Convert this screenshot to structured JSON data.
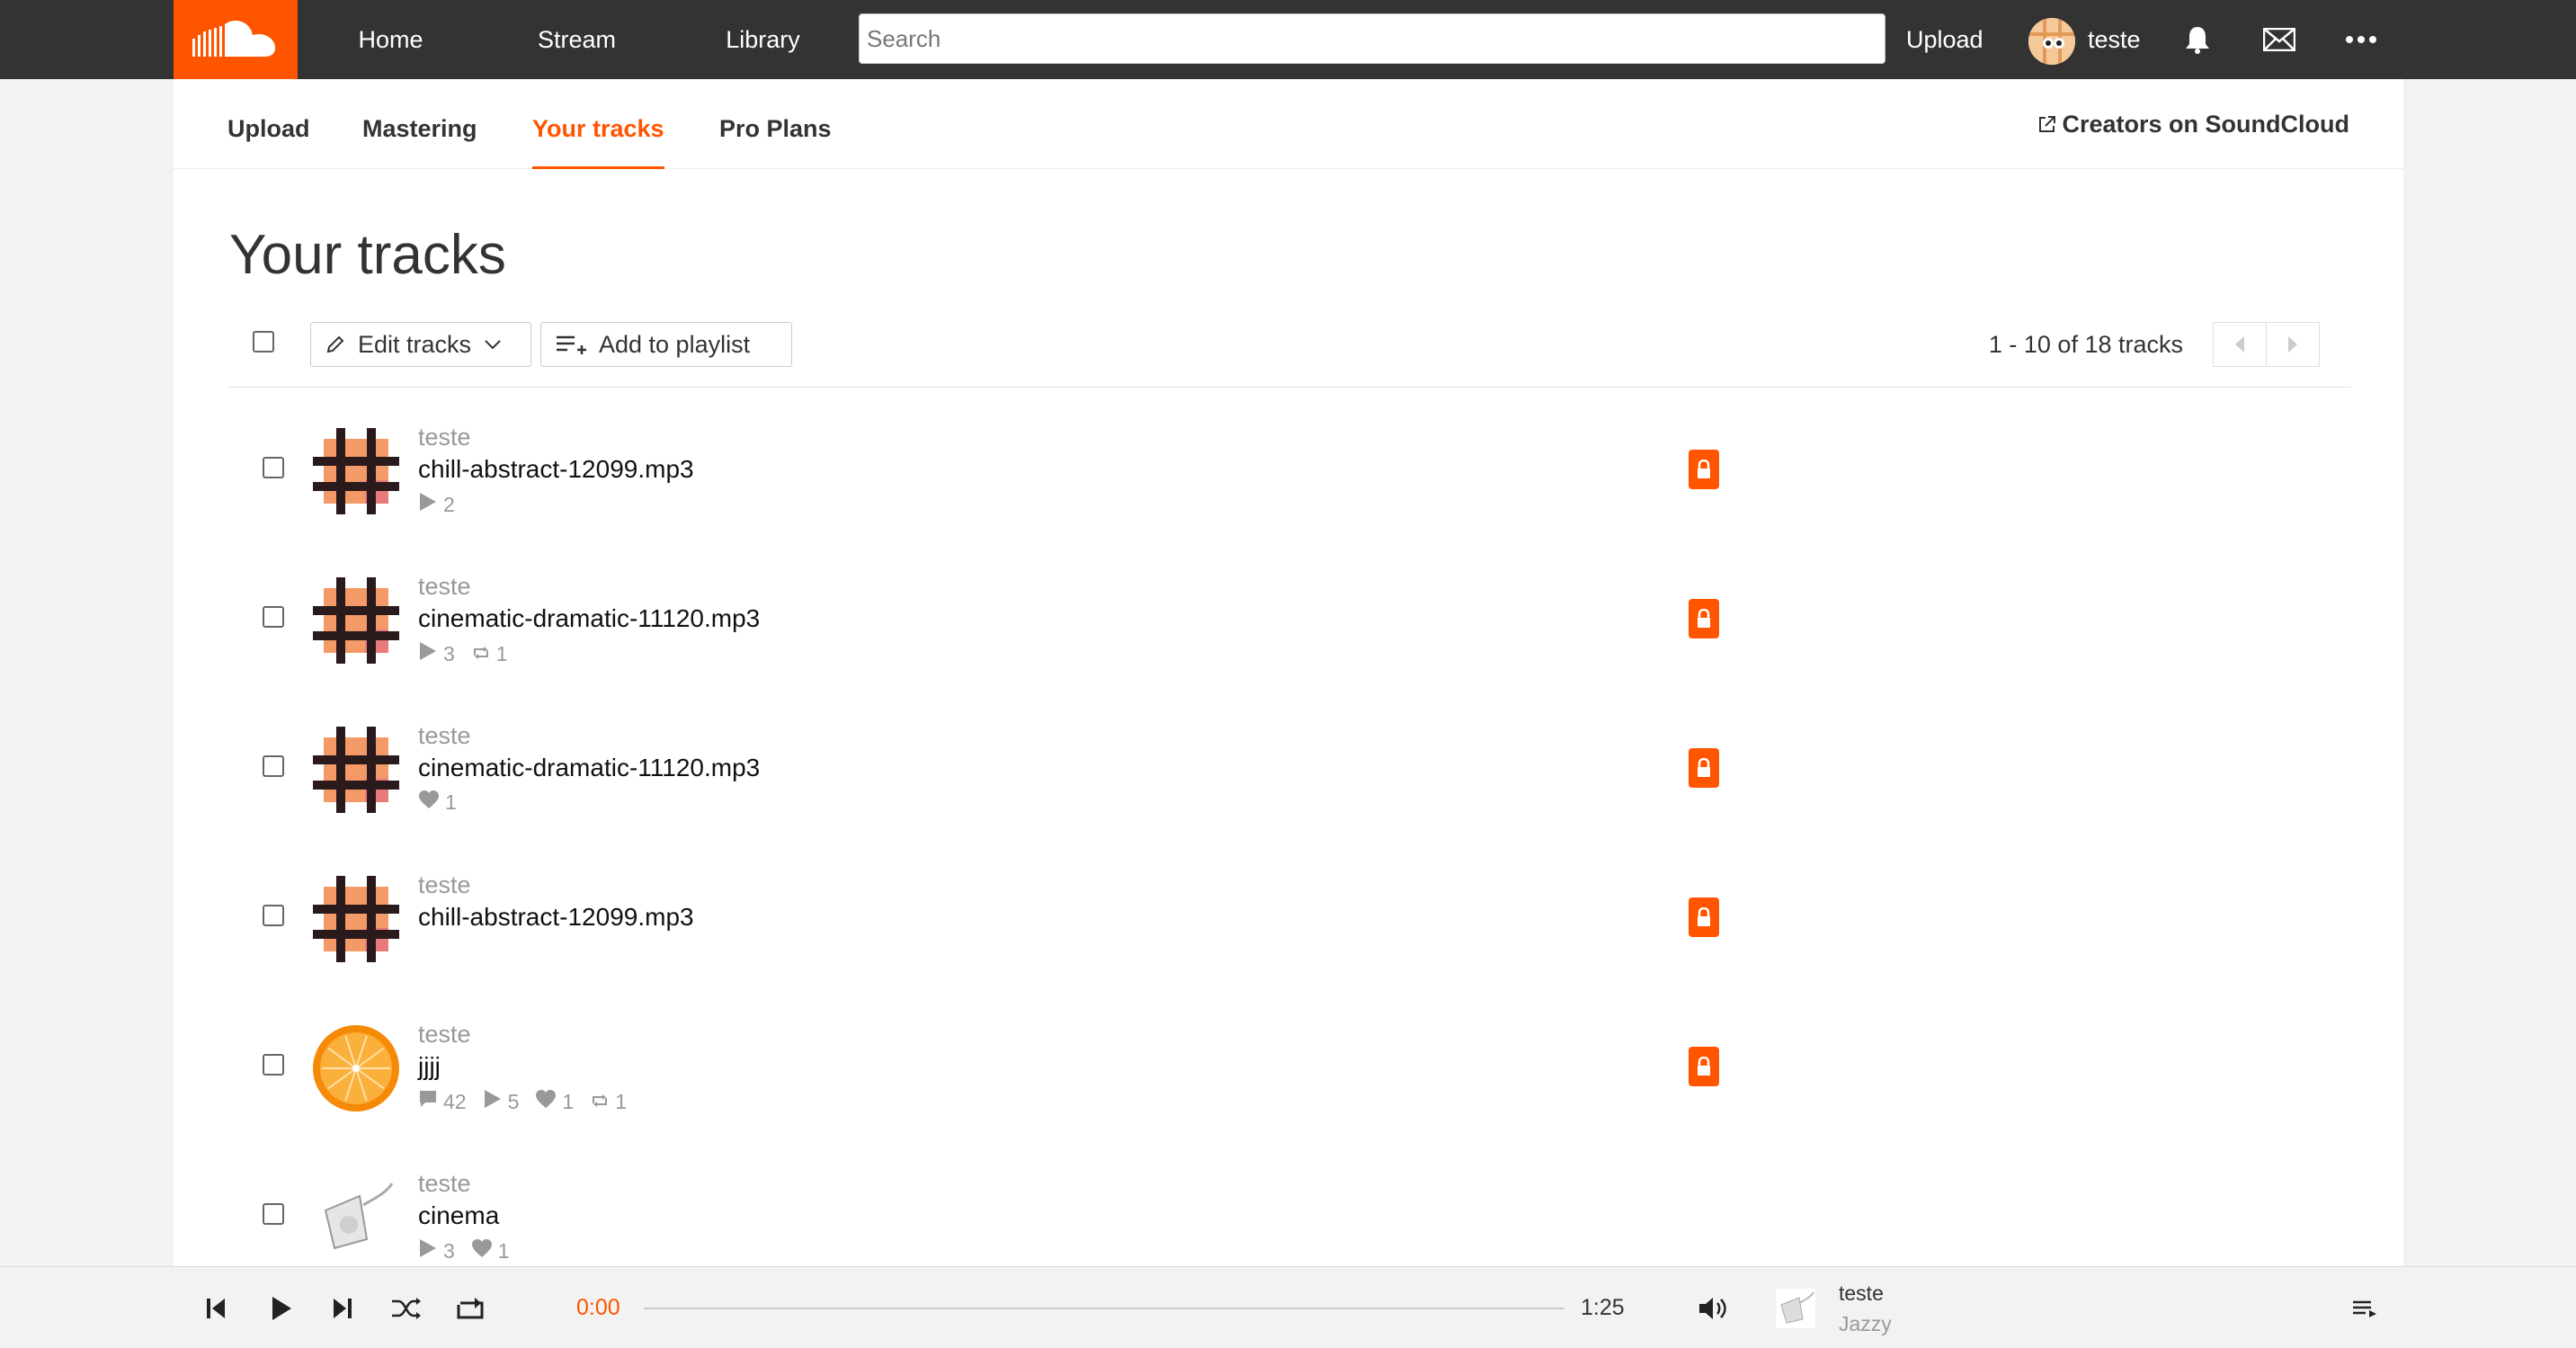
{
  "header": {
    "nav": [
      "Home",
      "Stream",
      "Library"
    ],
    "search_placeholder": "Search",
    "upload_label": "Upload",
    "username": "teste"
  },
  "subnav": {
    "items": [
      "Upload",
      "Mastering",
      "Your tracks",
      "Pro Plans"
    ],
    "active": "Your tracks",
    "creators_label": "Creators on SoundCloud"
  },
  "page_title": "Your tracks",
  "toolbar": {
    "edit_tracks": "Edit tracks",
    "add_to_playlist": "Add to playlist",
    "pagination": "1 - 10 of 18 tracks"
  },
  "tracks": [
    {
      "user": "teste",
      "title": "chill-abstract-12099.mp3",
      "art": "grid-art",
      "private": true,
      "stats": [
        {
          "icon": "play-icon",
          "value": "2"
        }
      ]
    },
    {
      "user": "teste",
      "title": "cinematic-dramatic-11120.mp3",
      "art": "grid-art",
      "private": true,
      "stats": [
        {
          "icon": "play-icon",
          "value": "3"
        },
        {
          "icon": "repost-icon",
          "value": "1"
        }
      ]
    },
    {
      "user": "teste",
      "title": "cinematic-dramatic-11120.mp3",
      "art": "grid-art",
      "private": true,
      "stats": [
        {
          "icon": "heart-icon",
          "value": "1"
        }
      ]
    },
    {
      "user": "teste",
      "title": "chill-abstract-12099.mp3",
      "art": "grid-art",
      "private": true,
      "stats": []
    },
    {
      "user": "teste",
      "title": "jjjj",
      "art": "orange-art",
      "private": true,
      "stats": [
        {
          "icon": "comment-icon",
          "value": "42"
        },
        {
          "icon": "play-icon",
          "value": "5"
        },
        {
          "icon": "heart-icon",
          "value": "1"
        },
        {
          "icon": "repost-icon",
          "value": "1"
        }
      ]
    },
    {
      "user": "teste",
      "title": "cinema",
      "art": "speaker-art",
      "private": false,
      "stats": [
        {
          "icon": "play-icon",
          "value": "3"
        },
        {
          "icon": "heart-icon",
          "value": "1"
        }
      ]
    }
  ],
  "player": {
    "current_time": "0:00",
    "duration": "1:25",
    "track_user": "teste",
    "track_title": "Jazzy"
  },
  "colors": {
    "accent": "#ff5500",
    "header_bg": "#333333"
  }
}
